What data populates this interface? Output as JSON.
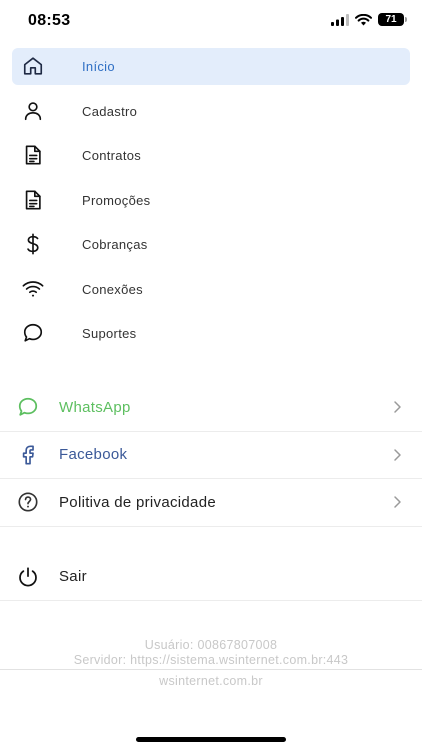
{
  "status_bar": {
    "time": "08:53",
    "battery": "71"
  },
  "menu": {
    "items": [
      {
        "label": "Início",
        "icon": "home-icon",
        "active": true
      },
      {
        "label": "Cadastro",
        "icon": "user-icon"
      },
      {
        "label": "Contratos",
        "icon": "document-icon"
      },
      {
        "label": "Promoções",
        "icon": "document-icon"
      },
      {
        "label": "Cobranças",
        "icon": "dollar-icon"
      },
      {
        "label": "Conexões",
        "icon": "wifi-icon"
      },
      {
        "label": "Suportes",
        "icon": "chat-bubble-icon"
      }
    ]
  },
  "links": {
    "whatsapp": "WhatsApp",
    "facebook": "Facebook",
    "privacy": "Politiva de privacidade"
  },
  "logout": {
    "label": "Sair"
  },
  "footer": {
    "user": "Usuário: 00867807008",
    "server": "Servidor: https://sistema.wsinternet.com.br:443",
    "site": "wsinternet.com.br"
  },
  "colors": {
    "active_bg": "#e3edfb",
    "active_text": "#2f6fc4",
    "whatsapp": "#5dbf60",
    "facebook": "#3b5998",
    "footer_text": "#c8c8c8"
  }
}
